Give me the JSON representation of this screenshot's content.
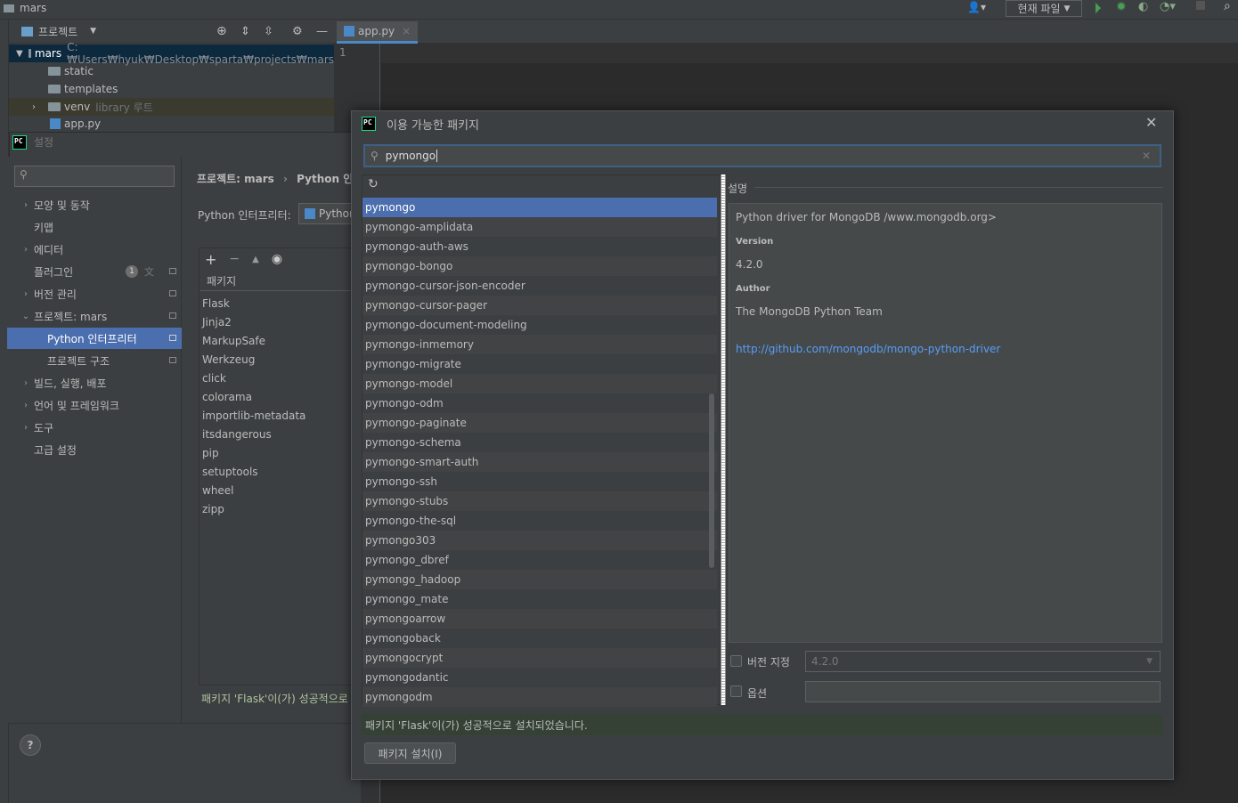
{
  "window": {
    "title": "mars"
  },
  "toolbar": {
    "run_config": "현재 파일",
    "user_icon": "user-icon",
    "run_icon": "run-icon",
    "debug_icon": "debug-icon",
    "search_icon": "search-icon"
  },
  "project_panel": {
    "view_label": "프로젝트",
    "tree": [
      {
        "name": "mars",
        "path": "C:₩Users₩hyuk₩Desktop₩sparta₩projects₩mars"
      },
      {
        "name": "static"
      },
      {
        "name": "templates"
      },
      {
        "name": "venv",
        "path": "library 루트"
      },
      {
        "name": "app.py"
      }
    ]
  },
  "editor": {
    "tab": "app.py",
    "line_number": "1"
  },
  "settings": {
    "title": "설정",
    "nav": [
      {
        "label": "모양 및 동작"
      },
      {
        "label": "키맵"
      },
      {
        "label": "에디터"
      },
      {
        "label": "플러그인",
        "badge": "1"
      },
      {
        "label": "버전 관리"
      },
      {
        "label": "프로젝트: mars"
      },
      {
        "label": "Python 인터프리터"
      },
      {
        "label": "프로젝트 구조"
      },
      {
        "label": "빌드, 실행, 배포"
      },
      {
        "label": "언어 및 프레임워크"
      },
      {
        "label": "도구"
      },
      {
        "label": "고급 설정"
      }
    ],
    "breadcrumb_project": "프로젝트: mars",
    "breadcrumb_sep": "›",
    "breadcrumb_page": "Python 인터",
    "interpreter_label": "Python 인터프리터:",
    "interpreter_value": "Python",
    "package_column": "패키지",
    "packages": [
      "Flask",
      "Jinja2",
      "MarkupSafe",
      "Werkzeug",
      "click",
      "colorama",
      "importlib-metadata",
      "itsdangerous",
      "pip",
      "setuptools",
      "wheel",
      "zipp"
    ],
    "status": "패키지 'Flask'이(가) 성공적으로",
    "help": "?"
  },
  "available": {
    "title": "이용 가능한 패키지",
    "close": "✕",
    "search_value": "pymongo",
    "items": [
      "pymongo",
      "pymongo-amplidata",
      "pymongo-auth-aws",
      "pymongo-bongo",
      "pymongo-cursor-json-encoder",
      "pymongo-cursor-pager",
      "pymongo-document-modeling",
      "pymongo-inmemory",
      "pymongo-migrate",
      "pymongo-model",
      "pymongo-odm",
      "pymongo-paginate",
      "pymongo-schema",
      "pymongo-smart-auth",
      "pymongo-ssh",
      "pymongo-stubs",
      "pymongo-the-sql",
      "pymongo303",
      "pymongo_dbref",
      "pymongo_hadoop",
      "pymongo_mate",
      "pymongoarrow",
      "pymongoback",
      "pymongocrypt",
      "pymongodantic",
      "pymongodm"
    ],
    "description_label": "설명",
    "description": "Python driver for MongoDB /www.mongodb.org>",
    "version_head": "Version",
    "version": "4.2.0",
    "author_head": "Author",
    "author": "The MongoDB Python Team",
    "link": "http://github.com/mongodb/mongo-python-driver",
    "specify_version_label": "버전 지정",
    "specify_version_value": "4.2.0",
    "options_label": "옵션",
    "status": "패키지 'Flask'이(가) 성공적으로 설치되었습니다.",
    "install_button": "패키지 설치(I)"
  }
}
